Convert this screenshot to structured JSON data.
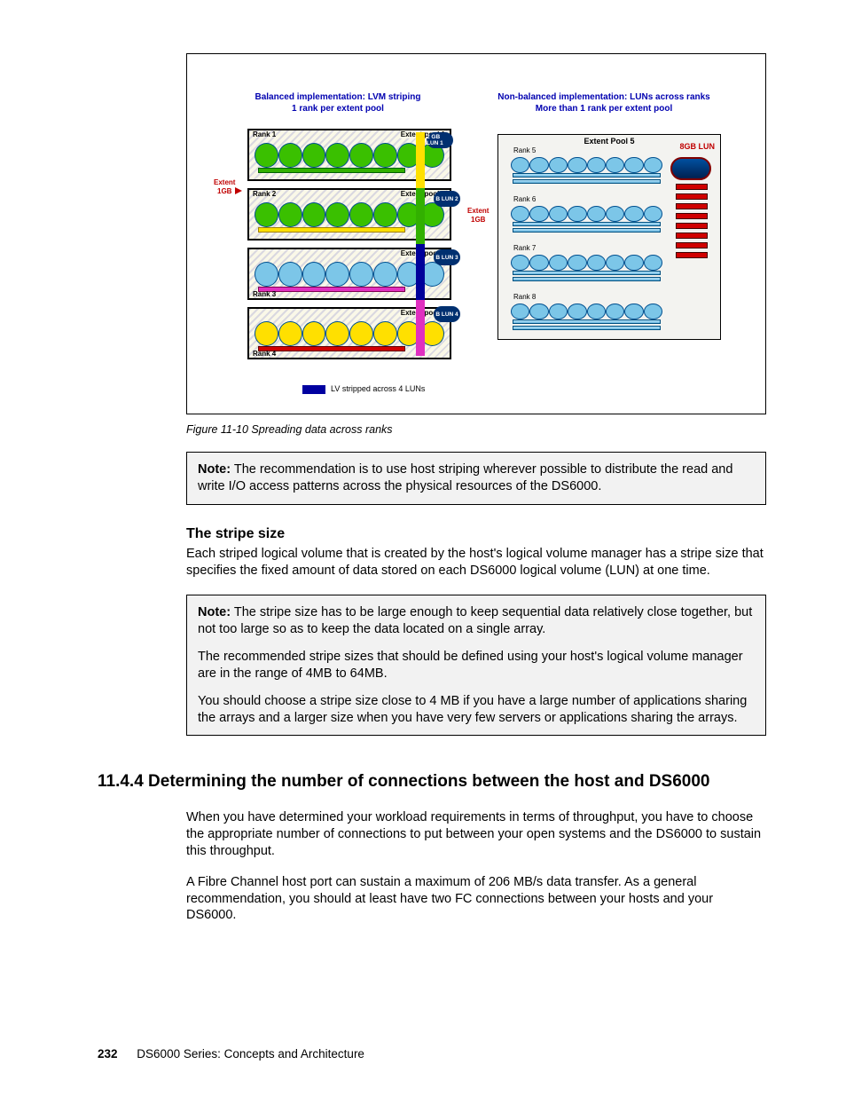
{
  "figure": {
    "left_header_line1": "Balanced implementation: LVM striping",
    "left_header_line2": "1 rank per extent pool",
    "right_header_line1": "Non-balanced implementation:  LUNs across ranks",
    "right_header_line2": "More than 1 rank per extent pool",
    "ranks_left": [
      "Rank 1",
      "Rank 2",
      "Rank 3",
      "Rank 4"
    ],
    "pools_left": [
      "Extent pool 1",
      "Extent pool 2",
      "Extent pool 3",
      "Extent pool 4"
    ],
    "luns_left": [
      "2 GB LUN 1",
      "B LUN 2",
      "B LUN 3",
      "B LUN 4"
    ],
    "extent_label": "Extent",
    "extent_size": "1GB",
    "right_pool": "Extent  Pool 5",
    "ranks_right": [
      "Rank 5",
      "Rank 6",
      "Rank 7",
      "Rank 8"
    ],
    "big_lun": "8GB LUN",
    "lv_caption": "LV stripped across 4 LUNs"
  },
  "caption": "Figure 11-10   Spreading data across ranks",
  "note1": "The recommendation is to use host striping wherever possible to distribute the read and write I/O access patterns across the physical resources of the DS6000.",
  "note_label": "Note:",
  "stripe_head": "The stripe size",
  "stripe_body": "Each striped logical volume that is created by the host's logical volume manager has a stripe size that specifies the fixed amount of data stored on each DS6000 logical volume (LUN) at one time.",
  "note2_p1": "The stripe size has to be large enough to keep sequential data relatively close together, but not too large so as to keep the data located on a single array.",
  "note2_p2": "The recommended stripe sizes that should be defined using your host's logical volume manager are in the range of 4MB to 64MB.",
  "note2_p3": "You should choose a stripe size close to 4 MB if you have a large number of applications sharing the arrays and a larger size when you have very few servers or applications sharing the arrays.",
  "section_head": "11.4.4  Determining the number of connections between the host and DS6000",
  "sec_p1": "When you have determined your workload requirements in terms of throughput, you have to choose the appropriate number of connections to put between your open systems and the DS6000 to sustain this throughput.",
  "sec_p2": "A Fibre Channel host port can sustain a maximum of 206 MB/s data transfer. As a general recommendation, you should at least have two FC connections between your hosts and your DS6000.",
  "footer_page": "232",
  "footer_title": "DS6000 Series: Concepts and Architecture"
}
